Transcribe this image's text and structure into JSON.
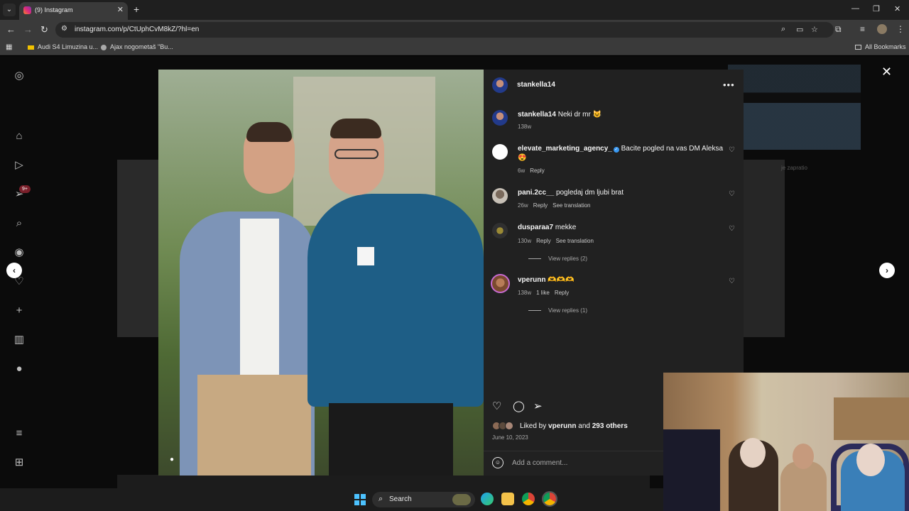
{
  "browser": {
    "tab_title": "(9) Instagram",
    "url": "instagram.com/p/CtUphCvM8kZ/?hl=en",
    "bookmarks": [
      {
        "label": "Audi S4 Limuzina u..."
      },
      {
        "label": "Ajax nogometaš \"Bu..."
      }
    ],
    "all_bookmarks": "All Bookmarks"
  },
  "sidebar": {
    "notification_badge": "9+",
    "icons": [
      "instagram-icon",
      "home-icon",
      "reels-icon",
      "messages-icon",
      "search-icon",
      "explore-icon",
      "notifications-icon",
      "create-icon",
      "dashboard-icon",
      "profile-icon",
      "menu-icon",
      "more-icon"
    ]
  },
  "post": {
    "owner": "stankella14",
    "caption": {
      "user": "stankella14",
      "text": "Neki dr mr 😺",
      "age": "138w"
    },
    "comments": [
      {
        "user": "elevate_marketing_agency_",
        "verified": true,
        "text": "Bacite pogled na vas DM Aleksa 😍",
        "age": "6w",
        "reply": "Reply"
      },
      {
        "user": "pani.2cc__",
        "text": "pogledaj dm ljubi brat",
        "age": "26w",
        "reply": "Reply",
        "translate": "See translation"
      },
      {
        "user": "dusparaa7",
        "text": "mekke",
        "age": "130w",
        "reply": "Reply",
        "translate": "See translation",
        "view_replies": "View replies (2)"
      },
      {
        "user": "vperunn",
        "text": "🫶🫶🫶",
        "age": "138w",
        "likes": "1 like",
        "reply": "Reply",
        "view_replies": "View replies (1)"
      }
    ],
    "likes": {
      "prefix": "Liked by",
      "user": "vperunn",
      "joiner": "and",
      "others": "293 others"
    },
    "date": "June 10, 2023",
    "comment_placeholder": "Add a comment..."
  },
  "taskbar": {
    "search_label": "Search"
  },
  "background": {
    "faded_text": "je zapratio"
  }
}
